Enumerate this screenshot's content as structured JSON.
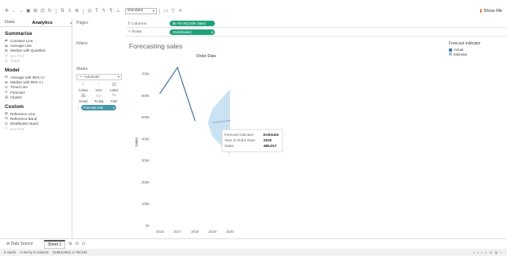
{
  "toolbar": {
    "fit_value": "Standard",
    "show_me_label": "Show Me",
    "icons": [
      "tableau-logo-icon",
      "back-icon",
      "forward-icon",
      "save-icon",
      "add-datasource-icon",
      "new-sheet-icon",
      "redo-icon",
      "swap-icon",
      "sort-asc-icon",
      "sort-desc-icon",
      "group-icon",
      "label-icon",
      "highlight-icon",
      "format-icon",
      "fix-axes-icon",
      "fit-icon",
      "presentation-icon",
      "share-icon"
    ]
  },
  "left_pane": {
    "tab_data": "Data",
    "tab_analytics": "Analytics",
    "sections": [
      {
        "title": "Summarise",
        "items": [
          {
            "label": "Constant Line",
            "icon": "constant-line-icon",
            "enabled": true
          },
          {
            "label": "Average Line",
            "icon": "average-line-icon",
            "enabled": true
          },
          {
            "label": "Median with Quartiles",
            "icon": "median-quartiles-icon",
            "enabled": true
          },
          {
            "label": "Box Plot",
            "icon": "box-plot-icon",
            "enabled": false
          },
          {
            "label": "Totals",
            "icon": "totals-icon",
            "enabled": false
          }
        ]
      },
      {
        "title": "Model",
        "items": [
          {
            "label": "Average with 95% CI",
            "icon": "average-ci-icon",
            "enabled": true
          },
          {
            "label": "Median with 95% CI",
            "icon": "median-ci-icon",
            "enabled": true
          },
          {
            "label": "Trend Line",
            "icon": "trend-line-icon",
            "enabled": true
          },
          {
            "label": "Forecast",
            "icon": "forecast-icon",
            "enabled": true
          },
          {
            "label": "Cluster",
            "icon": "cluster-icon",
            "enabled": true
          }
        ]
      },
      {
        "title": "Custom",
        "items": [
          {
            "label": "Reference Line",
            "icon": "reference-line-icon",
            "enabled": true
          },
          {
            "label": "Reference Band",
            "icon": "reference-band-icon",
            "enabled": true
          },
          {
            "label": "Distribution Band",
            "icon": "distribution-band-icon",
            "enabled": true
          },
          {
            "label": "Box Plot",
            "icon": "box-plot-icon",
            "enabled": false
          }
        ]
      }
    ]
  },
  "cards": {
    "pages_title": "Pages",
    "filters_title": "Filters",
    "marks_title": "Marks",
    "mark_type": "Automatic",
    "mark_buttons": [
      "Colour",
      "Size",
      "Label",
      "Detail",
      "Tooltip",
      "Path"
    ],
    "colour_pill": "Forecast indi.."
  },
  "shelves": {
    "columns_label": "Columns",
    "columns_pill": "YEAR(Order Date)",
    "rows_label": "Rows",
    "rows_pill": "SUM(Sales)"
  },
  "view": {
    "title": "Forecasting sales"
  },
  "legend": {
    "title": "Forecast indicator",
    "items": [
      {
        "label": "Actual",
        "color": "#4e79a7"
      },
      {
        "label": "Estimate",
        "color": "#a0cbe8"
      }
    ]
  },
  "chart_data": {
    "type": "line",
    "title": "Order Date",
    "xlabel": "",
    "ylabel": "Sales",
    "x": [
      2016,
      2017,
      2018,
      2019,
      2020
    ],
    "x_tick_labels": [
      "2016",
      "2017",
      "2018",
      "2019",
      "2020"
    ],
    "y_ticks": [
      0,
      100000,
      200000,
      300000,
      400000,
      500000,
      600000,
      700000
    ],
    "y_tick_labels": [
      "0K",
      "100K",
      "200K",
      "300K",
      "400K",
      "500K",
      "600K",
      "700K"
    ],
    "ylim": [
      0,
      770000
    ],
    "series": [
      {
        "name": "Actual",
        "color": "#4e79a7",
        "x": [
          2016,
          2017,
          2018
        ],
        "values": [
          610000,
          730000,
          485000
        ]
      },
      {
        "name": "Estimate",
        "color": "#86b4d8",
        "x": [
          2019,
          2020
        ],
        "values": [
          475000,
          485017
        ]
      }
    ],
    "band": {
      "x": [
        2019,
        2020
      ],
      "upper": [
        540000,
        630000
      ],
      "lower": [
        410000,
        330000
      ],
      "color": "#a0cbe8"
    },
    "gridlines": false,
    "tooltip": {
      "rows": [
        {
          "label": "Forecast indicator:",
          "value": "Estimate"
        },
        {
          "label": "Year of Order Date:",
          "value": "2020"
        },
        {
          "label": "Sales:",
          "value": "485,017"
        }
      ]
    }
  },
  "bottom": {
    "data_source_label": "Data Source",
    "sheet_label": "Sheet 1",
    "status": {
      "marks": "5 marks",
      "rows_cols": "1 row by 5 columns",
      "sum": "SUM(Sales): 2,784,532"
    }
  }
}
